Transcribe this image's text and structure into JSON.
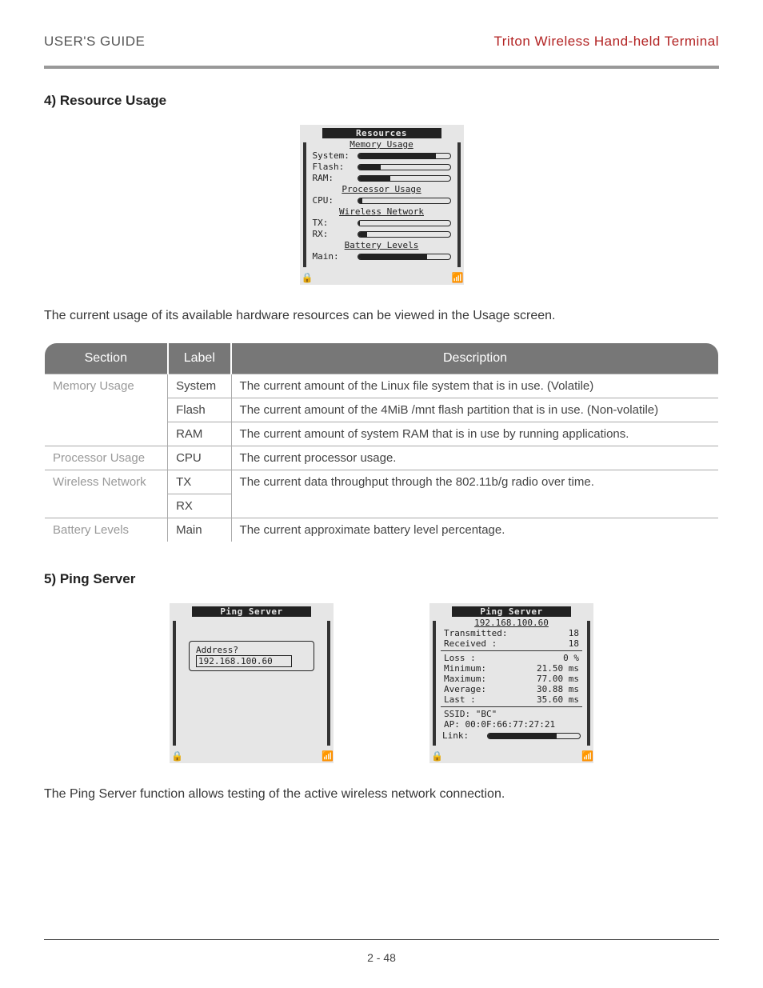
{
  "header": {
    "left": "USER'S GUIDE",
    "right": "Triton Wireless Hand-held Terminal"
  },
  "section4": {
    "heading": "4) Resource Usage",
    "body": "The current usage of its available hardware resources can be viewed in the Usage screen.",
    "lcd": {
      "title": "Resources",
      "groups": [
        {
          "heading": "Memory Usage",
          "rows": [
            {
              "label": "System:",
              "pct": 85
            },
            {
              "label": "Flash:",
              "pct": 25
            },
            {
              "label": "RAM:",
              "pct": 35
            }
          ]
        },
        {
          "heading": "Processor Usage",
          "rows": [
            {
              "label": "CPU:",
              "pct": 5
            }
          ]
        },
        {
          "heading": "Wireless Network",
          "rows": [
            {
              "label": "TX:",
              "pct": 2
            },
            {
              "label": "RX:",
              "pct": 10
            }
          ]
        },
        {
          "heading": "Battery Levels",
          "rows": [
            {
              "label": "Main:",
              "pct": 75
            }
          ]
        }
      ]
    },
    "table": {
      "headers": [
        "Section",
        "Label",
        "Description"
      ],
      "rows": [
        {
          "section": "Memory Usage",
          "span": 3,
          "label": "System",
          "desc": "The current amount of the Linux file system that is in use. (Volatile)"
        },
        {
          "section": "",
          "label": "Flash",
          "desc": "The current amount of the 4MiB /mnt flash partition that is in use. (Non-volatile)"
        },
        {
          "section": "",
          "label": "RAM",
          "desc": "The current amount of system RAM that is in use by running applications."
        },
        {
          "section": "Processor Usage",
          "span": 1,
          "label": "CPU",
          "desc": "The current processor usage."
        },
        {
          "section": "Wireless Network",
          "span": 2,
          "label": "TX",
          "desc": "The current data throughput through the 802.11b/g radio over time."
        },
        {
          "section": "",
          "label": "RX",
          "desc": ""
        },
        {
          "section": "Battery Levels",
          "span": 1,
          "label": "Main",
          "desc": "The current approximate battery level percentage."
        }
      ]
    }
  },
  "section5": {
    "heading": "5) Ping Server",
    "lcd1": {
      "title": "Ping Server",
      "prompt": "Address?",
      "value": "192.168.100.60"
    },
    "lcd2": {
      "title": "Ping Server",
      "ip": "192.168.100.60",
      "stats": [
        {
          "k": "Transmitted:",
          "v": "18"
        },
        {
          "k": "Received  :",
          "v": "18"
        },
        {
          "k": "Loss  :",
          "v": "0 %"
        },
        {
          "k": "Minimum:",
          "v": "21.50 ms"
        },
        {
          "k": "Maximum:",
          "v": "77.00 ms"
        },
        {
          "k": "Average:",
          "v": "30.88 ms"
        },
        {
          "k": "Last  :",
          "v": "35.60 ms"
        }
      ],
      "ssid": "SSID: \"BC\"",
      "ap": "AP: 00:0F:66:77:27:21",
      "link_label": "Link:",
      "link_pct": 75
    },
    "body": "The Ping Server function allows testing of the active wireless network connection."
  },
  "page_number": "2 - 48"
}
